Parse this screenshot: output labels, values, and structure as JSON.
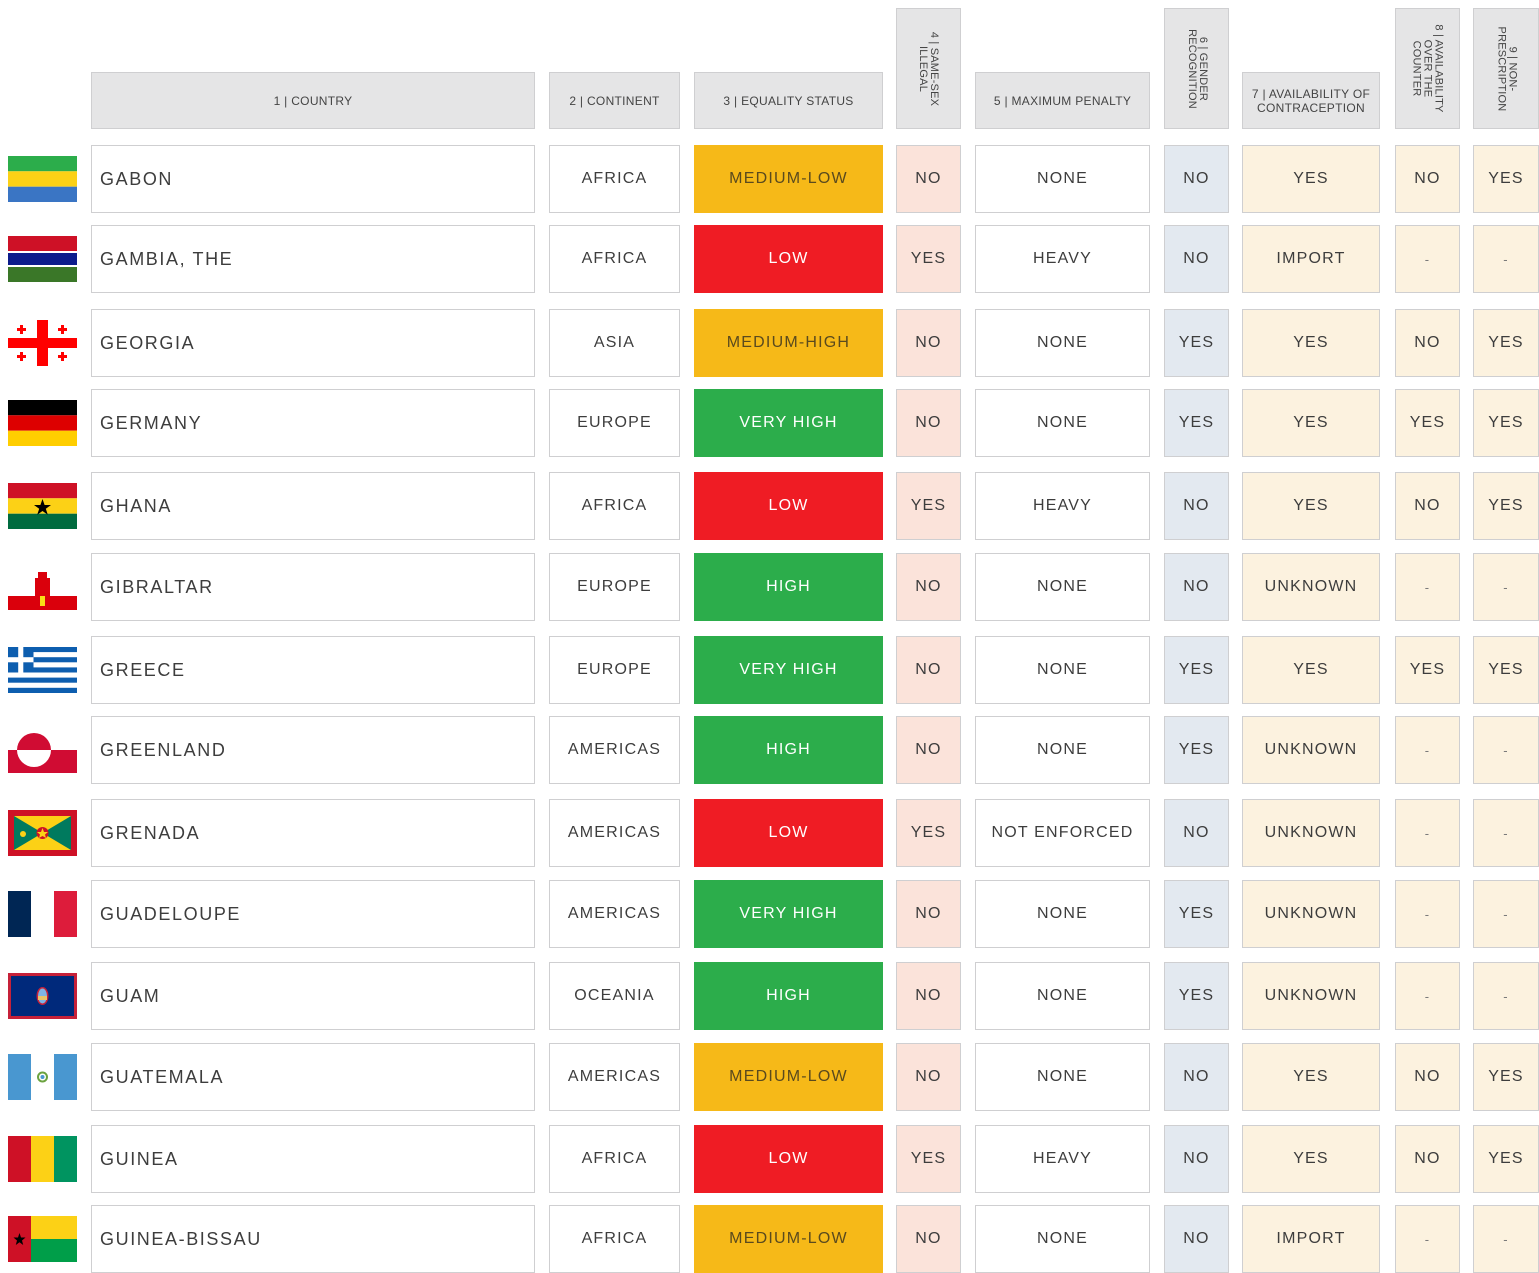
{
  "headers": {
    "country": "1 | COUNTRY",
    "continent": "2 | CONTINENT",
    "equality": "3 | EQUALITY STATUS",
    "illegal": "4 | SAME-SEX\nILLEGAL",
    "penalty": "5 | MAXIMUM PENALTY",
    "gender": "6 | GENDER\nRECOGNITION",
    "contraception": "7 | AVAILABILITY OF\nCONTRACEPTION",
    "otc": "8 | AVAILABILITY\nOVER THE\nCOUNTER",
    "nonprescription": "9 | NON-\nPRESCRIPTION"
  },
  "status_colors": {
    "MEDIUM-LOW": "#f6b918",
    "LOW": "#ef1c24",
    "MEDIUM-HIGH": "#f6b918",
    "VERY HIGH": "#2cad4b",
    "HIGH": "#2cad4b"
  },
  "rows": [
    {
      "flag": "gabon-flag",
      "country": "GABON",
      "continent": "AFRICA",
      "equality": "MEDIUM-LOW",
      "illegal": "NO",
      "penalty": "NONE",
      "gender": "NO",
      "contraception": "YES",
      "otc": "NO",
      "nonprescription": "YES"
    },
    {
      "flag": "gambia-flag",
      "country": "GAMBIA, THE",
      "continent": "AFRICA",
      "equality": "LOW",
      "illegal": "YES",
      "penalty": "HEAVY",
      "gender": "NO",
      "contraception": "IMPORT",
      "otc": "-",
      "nonprescription": "-"
    },
    {
      "flag": "georgia-flag",
      "country": "GEORGIA",
      "continent": "ASIA",
      "equality": "MEDIUM-HIGH",
      "illegal": "NO",
      "penalty": "NONE",
      "gender": "YES",
      "contraception": "YES",
      "otc": "NO",
      "nonprescription": "YES"
    },
    {
      "flag": "germany-flag",
      "country": "GERMANY",
      "continent": "EUROPE",
      "equality": "VERY HIGH",
      "illegal": "NO",
      "penalty": "NONE",
      "gender": "YES",
      "contraception": "YES",
      "otc": "YES",
      "nonprescription": "YES"
    },
    {
      "flag": "ghana-flag",
      "country": "GHANA",
      "continent": "AFRICA",
      "equality": "LOW",
      "illegal": "YES",
      "penalty": "HEAVY",
      "gender": "NO",
      "contraception": "YES",
      "otc": "NO",
      "nonprescription": "YES"
    },
    {
      "flag": "gibraltar-flag",
      "country": "GIBRALTAR",
      "continent": "EUROPE",
      "equality": "HIGH",
      "illegal": "NO",
      "penalty": "NONE",
      "gender": "NO",
      "contraception": "UNKNOWN",
      "otc": "-",
      "nonprescription": "-"
    },
    {
      "flag": "greece-flag",
      "country": "GREECE",
      "continent": "EUROPE",
      "equality": "VERY HIGH",
      "illegal": "NO",
      "penalty": "NONE",
      "gender": "YES",
      "contraception": "YES",
      "otc": "YES",
      "nonprescription": "YES"
    },
    {
      "flag": "greenland-flag",
      "country": "GREENLAND",
      "continent": "AMERICAS",
      "equality": "HIGH",
      "illegal": "NO",
      "penalty": "NONE",
      "gender": "YES",
      "contraception": "UNKNOWN",
      "otc": "-",
      "nonprescription": "-"
    },
    {
      "flag": "grenada-flag",
      "country": "GRENADA",
      "continent": "AMERICAS",
      "equality": "LOW",
      "illegal": "YES",
      "penalty": "NOT ENFORCED",
      "gender": "NO",
      "contraception": "UNKNOWN",
      "otc": "-",
      "nonprescription": "-"
    },
    {
      "flag": "guadeloupe-flag",
      "country": "GUADELOUPE",
      "continent": "AMERICAS",
      "equality": "VERY HIGH",
      "illegal": "NO",
      "penalty": "NONE",
      "gender": "YES",
      "contraception": "UNKNOWN",
      "otc": "-",
      "nonprescription": "-"
    },
    {
      "flag": "guam-flag",
      "country": "GUAM",
      "continent": "OCEANIA",
      "equality": "HIGH",
      "illegal": "NO",
      "penalty": "NONE",
      "gender": "YES",
      "contraception": "UNKNOWN",
      "otc": "-",
      "nonprescription": "-"
    },
    {
      "flag": "guatemala-flag",
      "country": "GUATEMALA",
      "continent": "AMERICAS",
      "equality": "MEDIUM-LOW",
      "illegal": "NO",
      "penalty": "NONE",
      "gender": "NO",
      "contraception": "YES",
      "otc": "NO",
      "nonprescription": "YES"
    },
    {
      "flag": "guinea-flag",
      "country": "GUINEA",
      "continent": "AFRICA",
      "equality": "LOW",
      "illegal": "YES",
      "penalty": "HEAVY",
      "gender": "NO",
      "contraception": "YES",
      "otc": "NO",
      "nonprescription": "YES"
    },
    {
      "flag": "guinea-bissau-flag",
      "country": "GUINEA-BISSAU",
      "continent": "AFRICA",
      "equality": "MEDIUM-LOW",
      "illegal": "NO",
      "penalty": "NONE",
      "gender": "NO",
      "contraception": "IMPORT",
      "otc": "-",
      "nonprescription": "-"
    }
  ]
}
